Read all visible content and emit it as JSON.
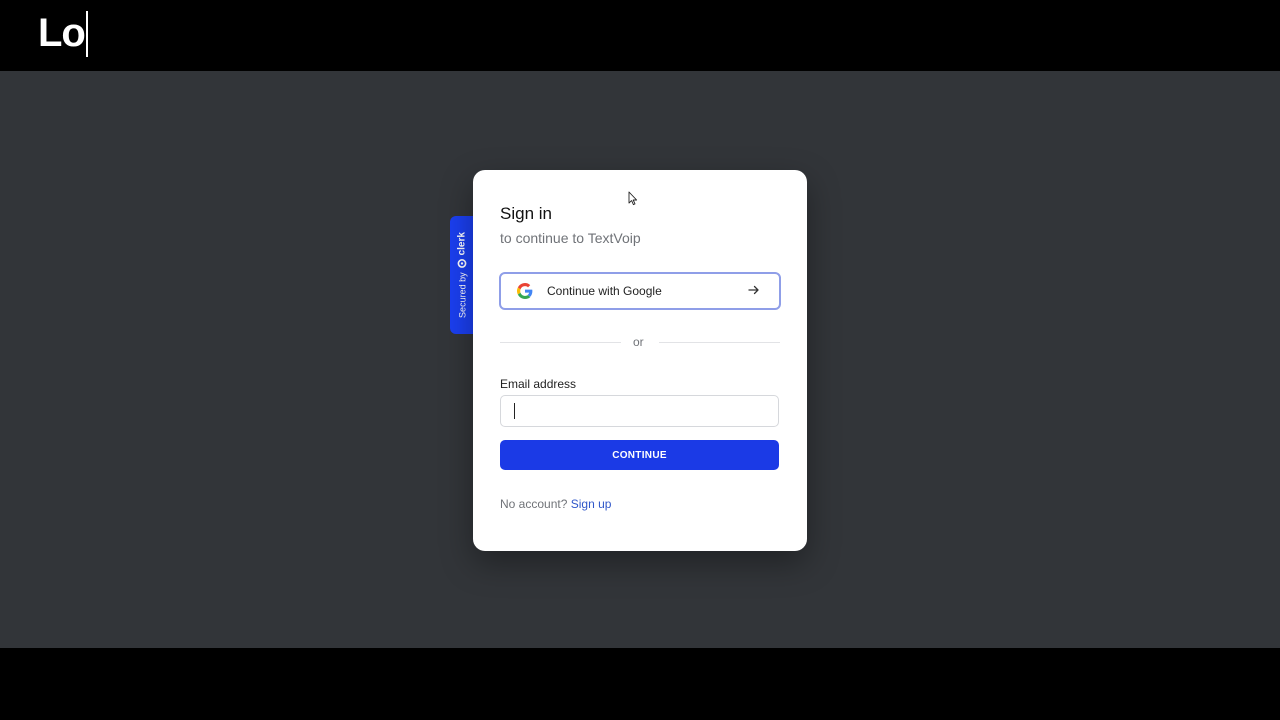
{
  "header": {
    "typed_text": "Lo"
  },
  "badge": {
    "secured_label": "Secured by",
    "brand_label": "clerk",
    "color": "#1b3ff0"
  },
  "card": {
    "title": "Sign in",
    "subtitle": "to continue to TextVoip",
    "google_button": {
      "label": "Continue with Google",
      "icon": "google-icon",
      "trailing_icon": "arrow-right-icon"
    },
    "divider_text": "or",
    "email": {
      "label": "Email address",
      "value": "",
      "placeholder": ""
    },
    "continue_label": "CONTINUE",
    "footer": {
      "prompt": "No account?",
      "link_label": "Sign up"
    }
  },
  "colors": {
    "accent": "#1b3ae6",
    "link": "#3057c9",
    "backdrop": "#323539"
  }
}
